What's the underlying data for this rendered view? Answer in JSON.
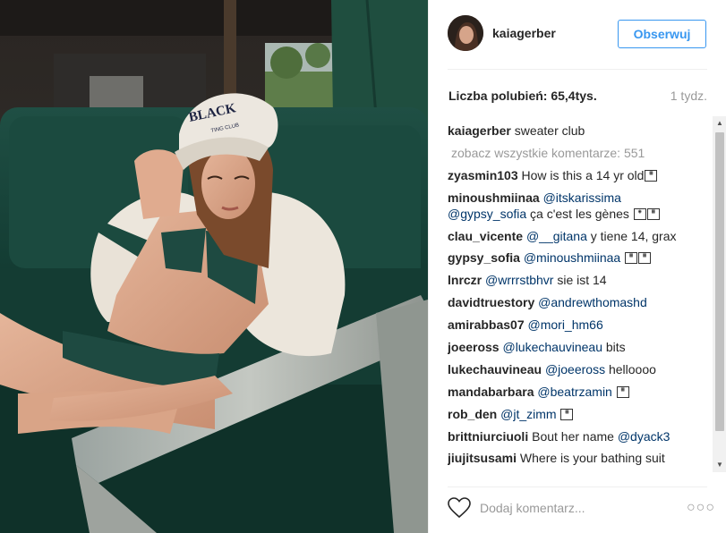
{
  "post": {
    "username": "kaiagerber",
    "follow_label": "Obserwuj",
    "likes_label": "Liczba polubień: 65,4tys.",
    "time_ago": "1 tydz.",
    "cap_text": "BLACK",
    "cap_sub": "TING CLUB"
  },
  "caption": {
    "user": "kaiagerber",
    "text": "sweater club"
  },
  "view_all_label": "zobacz wszystkie komentarze: 551",
  "comments": [
    {
      "user": "zyasmin103",
      "mention": "",
      "text": "How is this a 14 yr old",
      "emoji": "gif"
    },
    {
      "user": "minoushmiinaa",
      "mention": "@itskarissima",
      "mention2": "@gypsy_sofia",
      "text": "ça c'est les gènes",
      "emoji": "gif"
    },
    {
      "user": "clau_vicente",
      "mention": "@__gitana",
      "text": "y tiene 14, grax"
    },
    {
      "user": "gypsy_sofia",
      "mention": "@minoushmiinaa",
      "text": "",
      "emoji": "gif"
    },
    {
      "user": "lnrczr",
      "mention": "@wrrrstbhvr",
      "text": "sie ist 14"
    },
    {
      "user": "davidtruestory",
      "mention": "@andrewthomashd",
      "text": ""
    },
    {
      "user": "amirabbas07",
      "mention": "@mori_hm66",
      "text": ""
    },
    {
      "user": "joeeross",
      "mention": "@lukechauvineau",
      "text": "bits"
    },
    {
      "user": "lukechauvineau",
      "mention": "@joeeross",
      "text": "helloooo"
    },
    {
      "user": "mandabarbara",
      "mention": "@beatrzamin",
      "text": "",
      "emoji": "gif"
    },
    {
      "user": "rob_den",
      "mention": "@jt_zimm",
      "text": "",
      "emoji": "gif"
    },
    {
      "user": "brittniurciuoli",
      "text_before": "Bout her name",
      "mention": "@dyack3"
    },
    {
      "user": "jiujitsusami",
      "mention": "",
      "text": "Where is your bathing suit from?"
    }
  ],
  "footer": {
    "add_comment_placeholder": "Dodaj komentarz...",
    "more_label": "○○○"
  },
  "icons": {
    "heart": "heart-icon",
    "more": "more-options-icon",
    "emoji": "emoji-icon"
  },
  "colors": {
    "accent": "#3897f0",
    "mention": "#003569",
    "muted": "#999999",
    "text": "#262626"
  }
}
